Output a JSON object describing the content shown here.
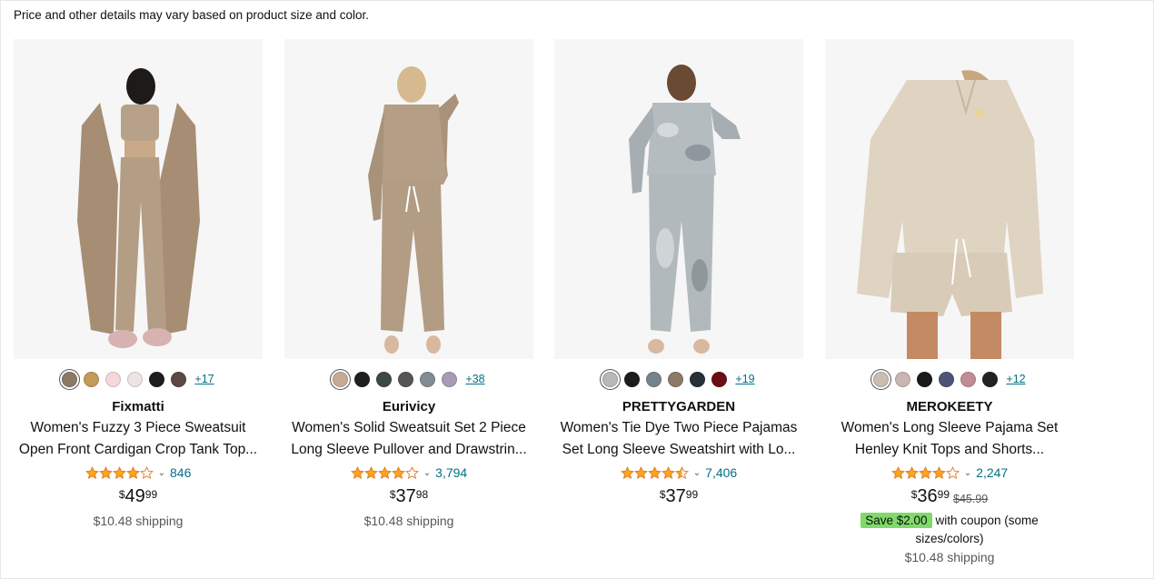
{
  "notice": "Price and other details may vary based on product size and color.",
  "products": [
    {
      "brand": "Fixmatti",
      "title_line1": "Women's Fuzzy 3 Piece Sweatsuit",
      "title_line2": "Open Front Cardigan Crop Tank Top...",
      "rating": 4.0,
      "reviews": "846",
      "price_symbol": "$",
      "price_whole": "49",
      "price_fraction": "99",
      "shipping": "$10.48 shipping",
      "more_swatches": "+17",
      "swatch_colors": [
        "#8c7865",
        "#c49a59",
        "#f3d8dc",
        "#efe3e3",
        "#1d1d1d",
        "#5b4a44"
      ],
      "image_colors": {
        "main": "#b49d85",
        "dark": "#8e7a66",
        "bg": "#f6f6f6"
      }
    },
    {
      "brand": "Eurivicy",
      "title_line1": "Women's Solid Sweatsuit Set 2 Piece",
      "title_line2": "Long Sleeve Pullover and Drawstrin...",
      "rating": 4.0,
      "reviews": "3,794",
      "price_symbol": "$",
      "price_whole": "37",
      "price_fraction": "98",
      "shipping": "$10.48 shipping",
      "more_swatches": "+38",
      "swatch_colors": [
        "#c7aa96",
        "#1f1f1f",
        "#3b4a44",
        "#555555",
        "#848c93",
        "#a99ab6"
      ],
      "image_colors": {
        "main": "#b49e86",
        "dark": "#97836d",
        "bg": "#f6f6f6"
      }
    },
    {
      "brand": "PRETTYGARDEN",
      "title_line1": "Women's Tie Dye Two Piece Pajamas",
      "title_line2": "Set Long Sleeve Sweatshirt with Lo...",
      "rating": 4.5,
      "reviews": "7,406",
      "price_symbol": "$",
      "price_whole": "37",
      "price_fraction": "99",
      "shipping": "",
      "more_swatches": "+19",
      "swatch_colors": [
        "#b6b9b8",
        "#1c1c1c",
        "#75838c",
        "#8b7a64",
        "#27313a",
        "#6b0f14"
      ],
      "image_colors": {
        "main": "#b5bcc0",
        "dark": "#8e979c",
        "bg": "#f6f6f6"
      }
    },
    {
      "brand": "MEROKEETY",
      "title_line1": "Women's Long Sleeve Pajama Set",
      "title_line2": "Henley Knit Tops and Shorts...",
      "rating": 4.0,
      "reviews": "2,247",
      "price_symbol": "$",
      "price_whole": "36",
      "price_fraction": "99",
      "list_price": "$45.99",
      "coupon_badge": "Save $2.00",
      "coupon_text": "with coupon (some sizes/colors)",
      "shipping": "$10.48 shipping",
      "more_swatches": "+12",
      "swatch_colors": [
        "#c9bcb1",
        "#c8b6b0",
        "#1a1a1a",
        "#4d5478",
        "#c08d94",
        "#222222"
      ],
      "image_colors": {
        "main": "#dfd3c1",
        "dark": "#c4b7a2",
        "bg": "#f6f6f6"
      }
    }
  ],
  "colors": {
    "star": "#ffa41c",
    "link": "#007185",
    "coupon_green": "#7fda69"
  }
}
